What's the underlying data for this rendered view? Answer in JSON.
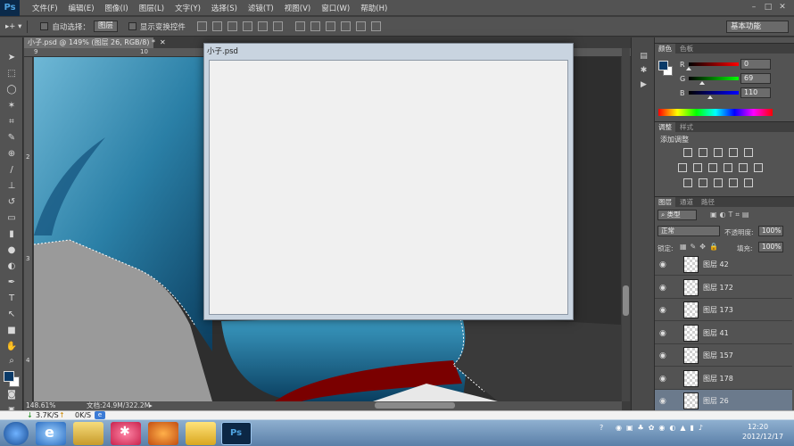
{
  "app": {
    "logo": "Ps"
  },
  "menu": [
    "文件(F)",
    "编辑(E)",
    "图像(I)",
    "图层(L)",
    "文字(Y)",
    "选择(S)",
    "滤镜(T)",
    "视图(V)",
    "窗口(W)",
    "帮助(H)"
  ],
  "options": {
    "auto_select": "自动选择：",
    "auto_select_value": "图层",
    "show_transform": "显示变换控件",
    "workspace": "基本功能"
  },
  "document": {
    "tab": "小子.psd @ 149% (图层 26, RGB/8) *",
    "zoom": "148.61%",
    "doc_info": "文档:24.9M/322.2M"
  },
  "rulers": {
    "top": [
      "9",
      "10"
    ],
    "left": [
      "2",
      "3",
      "4"
    ]
  },
  "dialog": {
    "title": "小子.psd"
  },
  "color_panel": {
    "tabs": [
      "颜色",
      "色板"
    ],
    "channels": [
      {
        "label": "R",
        "value": "0",
        "fraction": 0.0,
        "color_from": "#000000",
        "color_to": "#ff0000"
      },
      {
        "label": "G",
        "value": "69",
        "fraction": 0.27,
        "color_from": "#000000",
        "color_to": "#00ff00"
      },
      {
        "label": "B",
        "value": "110",
        "fraction": 0.43,
        "color_from": "#000000",
        "color_to": "#0000ff"
      }
    ]
  },
  "adjust_panel": {
    "tabs": [
      "调整",
      "样式"
    ],
    "title": "添加调整"
  },
  "layers_panel": {
    "tabs": [
      "图层",
      "通道",
      "路径"
    ],
    "filter_label": "类型",
    "blend_mode": "正常",
    "opacity_label": "不透明度:",
    "opacity": "100%",
    "lock_label": "锁定:",
    "fill_label": "填充:",
    "fill": "100%",
    "layers": [
      "图层 42",
      "图层 172",
      "图层 173",
      "图层 41",
      "图层 157",
      "图层 178",
      "图层 26"
    ],
    "selected_index": 6
  },
  "netspeed": {
    "down": "3.7K/S",
    "up": "0K/S"
  },
  "clock": {
    "time": "12:20",
    "date": "2012/12/17"
  },
  "colors": {
    "accent": "#0a3a68",
    "canvas_blue": "#2c7fa3",
    "red_band": "#8b0000"
  }
}
